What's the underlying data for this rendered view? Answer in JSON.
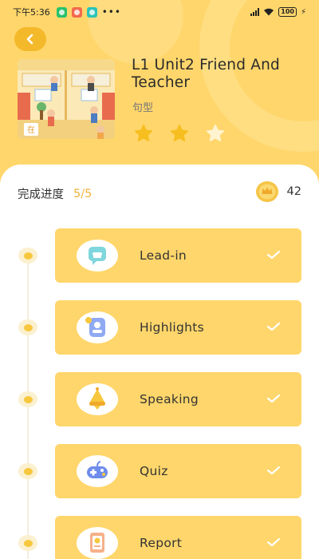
{
  "status_bar": {
    "time": "下午5:36",
    "battery": "100"
  },
  "header": {
    "title": "L1 Unit2 Friend And Teacher",
    "subtitle": "句型",
    "stars_earned": 2,
    "stars_total": 3,
    "thumbnail_sign": "在"
  },
  "progress": {
    "label": "完成进度",
    "value": "5/5"
  },
  "coins": {
    "count": "42"
  },
  "steps": [
    {
      "label": "Lead-in",
      "icon": "chat-bubble-icon",
      "completed": true
    },
    {
      "label": "Highlights",
      "icon": "contact-card-icon",
      "completed": true
    },
    {
      "label": "Speaking",
      "icon": "megaphone-icon",
      "completed": true
    },
    {
      "label": "Quiz",
      "icon": "gamepad-icon",
      "completed": true
    },
    {
      "label": "Report",
      "icon": "report-card-icon",
      "completed": true
    }
  ],
  "colors": {
    "accent": "#FFD66B",
    "accent_dark": "#F4B92A",
    "progress_text": "#F0B33A",
    "star_on": "#F6BE1F",
    "star_off": "#FFF3D0"
  }
}
